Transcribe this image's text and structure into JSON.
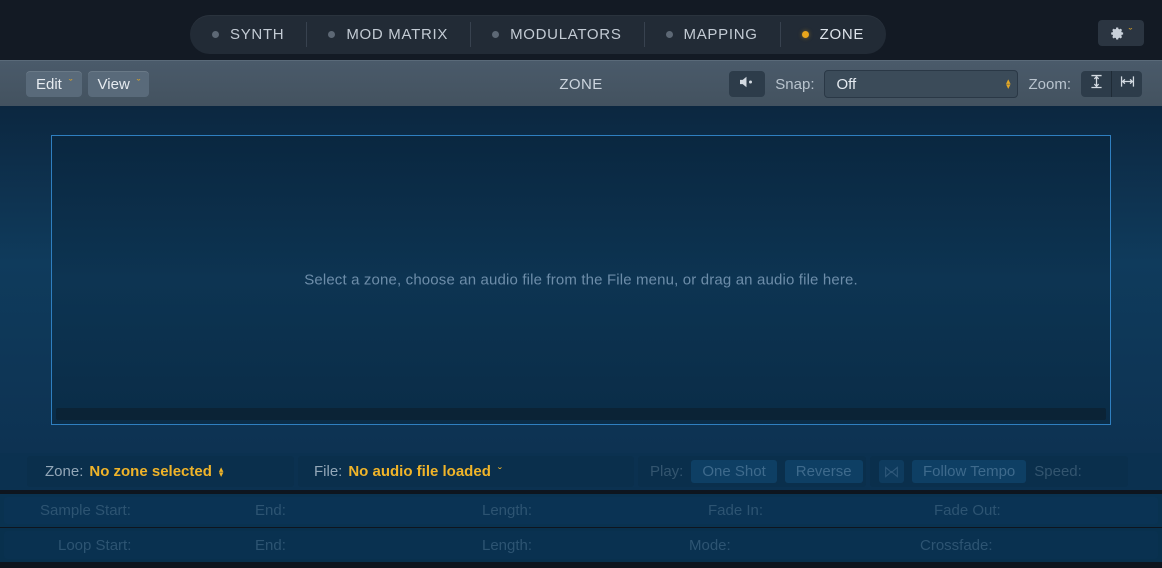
{
  "tabs": [
    {
      "label": "SYNTH",
      "active": false
    },
    {
      "label": "MOD MATRIX",
      "active": false
    },
    {
      "label": "MODULATORS",
      "active": false
    },
    {
      "label": "MAPPING",
      "active": false
    },
    {
      "label": "ZONE",
      "active": true
    }
  ],
  "gear": {
    "icon": "gear-icon",
    "chevron": "ˇ"
  },
  "toolbar": {
    "edit_label": "Edit",
    "view_label": "View",
    "chevron": "ˇ",
    "title": "ZONE",
    "speaker_icon": "speaker-icon",
    "snap_label": "Snap:",
    "snap_value": "Off",
    "stepper_up": "▴",
    "stepper_down": "▾",
    "zoom_label": "Zoom:",
    "zoom_vertical_icon": "zoom-vertical-icon",
    "zoom_horizontal_icon": "zoom-horizontal-icon"
  },
  "stage": {
    "placeholder": "Select a zone, choose an audio file from the File menu, or drag an audio file here."
  },
  "infobar": {
    "zone_label": "Zone:",
    "zone_value": "No zone selected",
    "zone_stepper_up": "▴",
    "zone_stepper_down": "▾",
    "file_label": "File:",
    "file_value": "No audio file loaded",
    "file_chevron": "ˇ",
    "play_label": "Play:",
    "play_one_shot": "One Shot",
    "play_reverse": "Reverse",
    "tempo_icon": "follow-tempo-icon",
    "follow_tempo": "Follow Tempo",
    "speed_label": "Speed:"
  },
  "params": {
    "row1": [
      "Sample Start:",
      "End:",
      "Length:",
      "Fade In:",
      "Fade Out:"
    ],
    "row2": [
      "Loop Start:",
      "End:",
      "Length:",
      "Mode:",
      "Crossfade:"
    ]
  },
  "colors": {
    "accent": "#f0b429",
    "tab_active_dot": "#e8a51c",
    "wave_border": "#2f7fc0",
    "toolbar": "#4a5a6a"
  }
}
